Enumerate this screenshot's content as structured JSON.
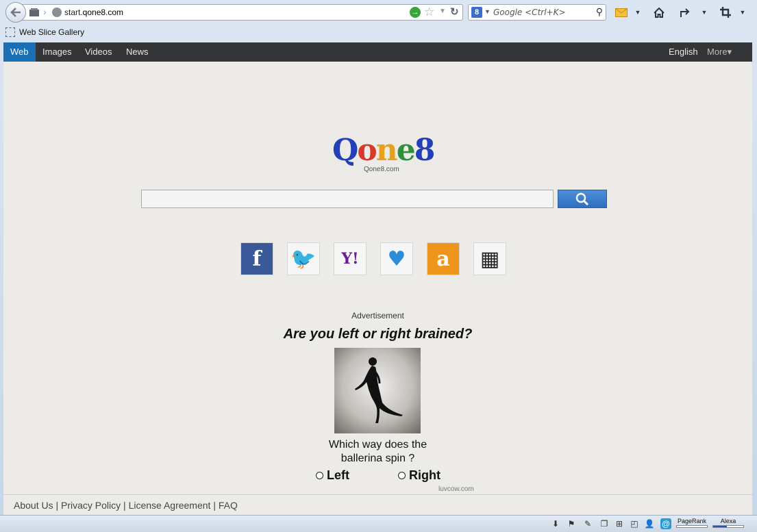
{
  "browser": {
    "url_prefix": "start.",
    "url_domain": "qone8.com",
    "search_placeholder": "Google <Ctrl+K>",
    "engine_letter": "8"
  },
  "bookmarks": {
    "item": "Web Slice Gallery"
  },
  "topnav": {
    "items": [
      "Web",
      "Images",
      "Videos",
      "News"
    ],
    "active": "Web",
    "language": "English",
    "more": "More▾"
  },
  "logo": {
    "letters": [
      "Q",
      "o",
      "n",
      "e",
      "8"
    ],
    "colors": [
      "#2340b8",
      "#d83a2a",
      "#e8a21a",
      "#2f8f3a",
      "#2340b8"
    ],
    "sub": "Qone8.com"
  },
  "search": {
    "value": ""
  },
  "social": [
    {
      "name": "facebook",
      "glyph": "f",
      "bg": "#3b5998",
      "fg": "#ffffff"
    },
    {
      "name": "twitter",
      "glyph": "🐦",
      "bg": "#f6f6f6",
      "fg": "#34a8df"
    },
    {
      "name": "yahoo",
      "glyph": "Y!",
      "bg": "#f6f6f6",
      "fg": "#6a1b9a"
    },
    {
      "name": "maps",
      "glyph": "♥",
      "bg": "#f6f6f6",
      "fg": "#2e8bd6"
    },
    {
      "name": "amazon",
      "glyph": "a",
      "bg": "#f0951c",
      "fg": "#ffffff"
    },
    {
      "name": "shopping",
      "glyph": "▦",
      "bg": "#f6f6f6",
      "fg": "#222222"
    }
  ],
  "ad": {
    "label": "Advertisement",
    "title": "Are you left or right brained?",
    "question_line1": "Which way does the",
    "question_line2": "ballerina spin ?",
    "option_left": "Left",
    "option_right": "Right",
    "credit": "luvcow.com"
  },
  "footer": {
    "links": [
      "About Us",
      "Privacy Policy",
      "License Agreement",
      "FAQ"
    ],
    "separator": " | "
  },
  "statusbar": {
    "pagerank_label": "PageRank",
    "alexa_label": "Alexa",
    "pagerank_fill": 0,
    "alexa_fill": 0.45
  }
}
